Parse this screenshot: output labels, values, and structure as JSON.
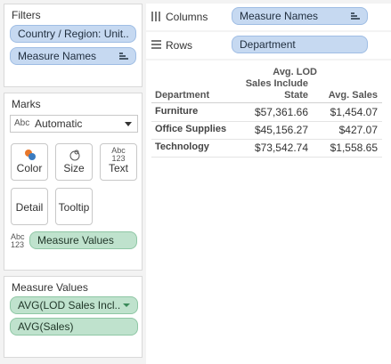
{
  "filters": {
    "title": "Filters",
    "items": [
      {
        "label": "Country / Region: Unit.."
      },
      {
        "label": "Measure Names"
      }
    ]
  },
  "marks": {
    "title": "Marks",
    "dropdown": {
      "icon_text": "Abc",
      "value": "Automatic"
    },
    "buttons": {
      "color": "Color",
      "size": "Size",
      "text": "Text",
      "detail": "Detail",
      "tooltip": "Tooltip"
    },
    "text_icon": {
      "top": "Abc",
      "bottom": "123"
    },
    "measure_values_pill": "Measure Values"
  },
  "measure_values_card": {
    "title": "Measure Values",
    "pills": [
      {
        "label": "AVG(LOD Sales Incl.."
      },
      {
        "label": "AVG(Sales)"
      }
    ]
  },
  "shelves": {
    "columns": {
      "label": "Columns",
      "pill": "Measure Names"
    },
    "rows": {
      "label": "Rows",
      "pill": "Department"
    }
  },
  "view": {
    "headers": {
      "row_header": "Department",
      "col1_line1": "Avg. LOD",
      "col1_line2": "Sales Include",
      "col1_line3": "State",
      "col2": "Avg. Sales"
    },
    "rows": [
      {
        "department": "Furniture",
        "lod": "$57,361.66",
        "sales": "$1,454.07"
      },
      {
        "department": "Office Supplies",
        "lod": "$45,156.27",
        "sales": "$427.07"
      },
      {
        "department": "Technology",
        "lod": "$73,542.74",
        "sales": "$1,558.65"
      }
    ]
  },
  "colors": {
    "blue_pill": "#c6d9f1",
    "green_pill": "#bfe2cd",
    "color_icon_orange": "#e8782b",
    "color_icon_blue": "#3b7bbf"
  }
}
